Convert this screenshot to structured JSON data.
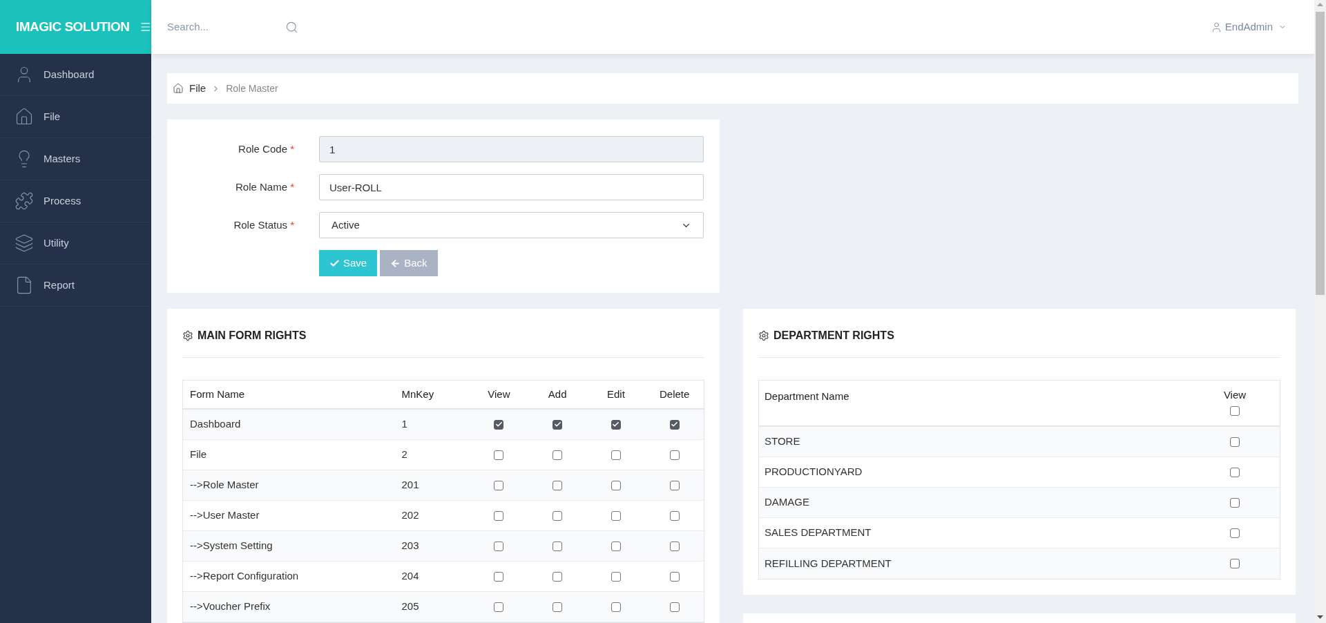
{
  "brand": "IMAGIC SOLUTION",
  "search": {
    "placeholder": "Search..."
  },
  "user": {
    "name": "EndAdmin"
  },
  "sidebar": {
    "items": [
      {
        "label": "Dashboard",
        "kind": "user"
      },
      {
        "label": "File",
        "kind": "home"
      },
      {
        "label": "Masters",
        "kind": "bulb"
      },
      {
        "label": "Process",
        "kind": "puzzle"
      },
      {
        "label": "Utility",
        "kind": "layers"
      },
      {
        "label": "Report",
        "kind": "file"
      }
    ]
  },
  "breadcrumb": [
    "File",
    "Role Master"
  ],
  "form": {
    "fields": [
      {
        "label": "Role Code",
        "mark": "*",
        "kind": "readonly",
        "value": "1"
      },
      {
        "label": "Role Name",
        "mark": "*",
        "kind": "text",
        "value": "User-ROLL"
      },
      {
        "label": "Role Status",
        "mark": "*",
        "kind": "select",
        "value": "Active"
      }
    ],
    "buttons": [
      {
        "label": "Save",
        "kind": "save"
      },
      {
        "label": "Back",
        "kind": "back"
      }
    ]
  },
  "main_form_rights": {
    "title": "MAIN FORM RIGHTS",
    "columns": [
      "Form Name",
      "MnKey",
      "View",
      "Add",
      "Edit",
      "Delete"
    ],
    "rows": [
      {
        "name": "Dashboard",
        "mnkey": "1",
        "view": true,
        "add": true,
        "edit": true,
        "delete": true
      },
      {
        "name": "File",
        "mnkey": "2",
        "view": false,
        "add": false,
        "edit": false,
        "delete": false
      },
      {
        "name": "-->Role Master",
        "mnkey": "201",
        "view": false,
        "add": false,
        "edit": false,
        "delete": false
      },
      {
        "name": "-->User Master",
        "mnkey": "202",
        "view": false,
        "add": false,
        "edit": false,
        "delete": false
      },
      {
        "name": "-->System Setting",
        "mnkey": "203",
        "view": false,
        "add": false,
        "edit": false,
        "delete": false
      },
      {
        "name": "-->Report Configuration",
        "mnkey": "204",
        "view": false,
        "add": false,
        "edit": false,
        "delete": false
      },
      {
        "name": "-->Voucher Prefix",
        "mnkey": "205",
        "view": false,
        "add": false,
        "edit": false,
        "delete": false
      }
    ]
  },
  "department_rights": {
    "title": "DEPARTMENT RIGHTS",
    "columns": [
      "Department Name",
      "View"
    ],
    "all_view": false,
    "rows": [
      {
        "name": "STORE",
        "view": false
      },
      {
        "name": "PRODUCTIONYARD",
        "view": false
      },
      {
        "name": "DAMAGE",
        "view": false
      },
      {
        "name": "SALES DEPARTMENT",
        "view": false
      },
      {
        "name": "REFILLING DEPARTMENT",
        "view": false
      }
    ]
  }
}
